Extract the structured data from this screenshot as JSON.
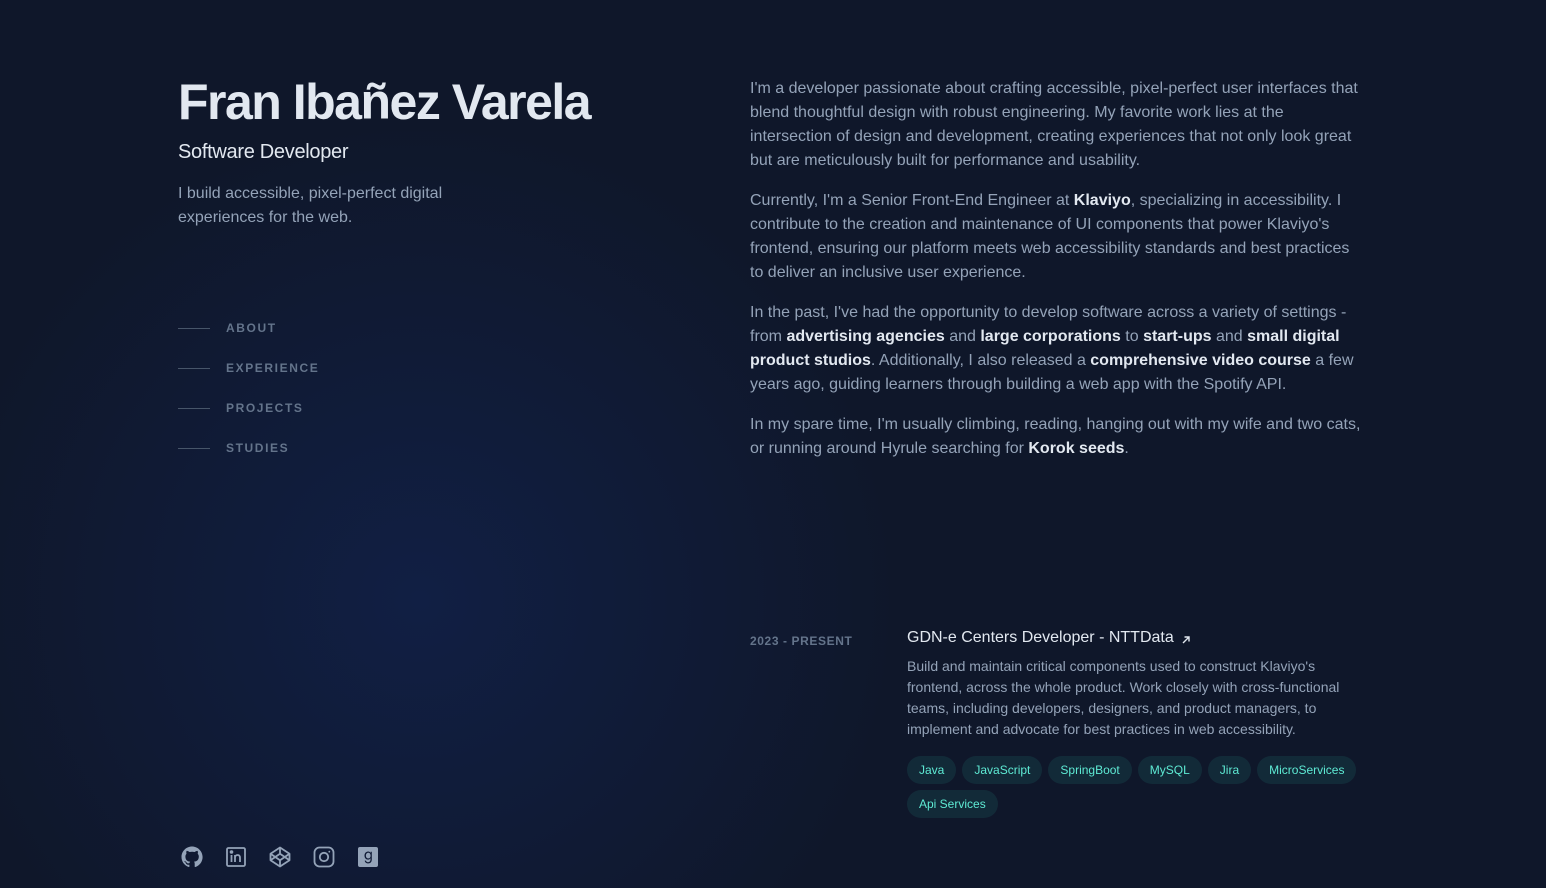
{
  "header": {
    "name": "Fran Ibañez Varela",
    "role": "Software Developer",
    "tagline": "I build accessible, pixel-perfect digital experiences for the web."
  },
  "nav": {
    "items": [
      {
        "label": "ABOUT"
      },
      {
        "label": "EXPERIENCE"
      },
      {
        "label": "PROJECTS"
      },
      {
        "label": "STUDIES"
      }
    ]
  },
  "socials": [
    "github-icon",
    "linkedin-icon",
    "codepen-icon",
    "instagram-icon",
    "goodreads-icon"
  ],
  "about": {
    "p1": "I'm a developer passionate about crafting accessible, pixel-perfect user interfaces that blend thoughtful design with robust engineering. My favorite work lies at the intersection of design and development, creating experiences that not only look great but are meticulously built for performance and usability.",
    "p2": {
      "before": "Currently, I'm a Senior Front-End Engineer at ",
      "b1": "Klaviyo",
      "after": ", specializing in accessibility. I contribute to the creation and maintenance of UI components that power Klaviyo's frontend, ensuring our platform meets web accessibility standards and best practices to deliver an inclusive user experience."
    },
    "p3": {
      "t1": "In the past, I've had the opportunity to develop software across a variety of settings - from ",
      "b1": "advertising agencies",
      "t2": " and ",
      "b2": "large corporations",
      "t3": " to ",
      "b3": "start-ups",
      "t4": " and ",
      "b4": "small digital product studios",
      "t5": ". Additionally, I also released a ",
      "b5": "comprehensive video course",
      "t6": " a few years ago, guiding learners through building a web app with the Spotify API."
    },
    "p4": {
      "t1": "In my spare time, I'm usually climbing, reading, hanging out with my wife and two cats, or running around Hyrule searching for ",
      "b1": "Korok seeds",
      "t2": "."
    }
  },
  "experience": {
    "date": "2023 - PRESENT",
    "title": "GDN-e Centers Developer - NTTData",
    "description": "Build and maintain critical components used to construct Klaviyo's frontend, across the whole product. Work closely with cross-functional teams, including developers, designers, and product managers, to implement and advocate for best practices in web accessibility.",
    "tags": [
      "Java",
      "JavaScript",
      "SpringBoot",
      "MySQL",
      "Jira",
      "MicroServices",
      "Api Services"
    ]
  },
  "colors": {
    "background": "#0f172a",
    "text": "#94a3b8",
    "heading": "#e2e8f0",
    "accent": "#5eead4"
  }
}
